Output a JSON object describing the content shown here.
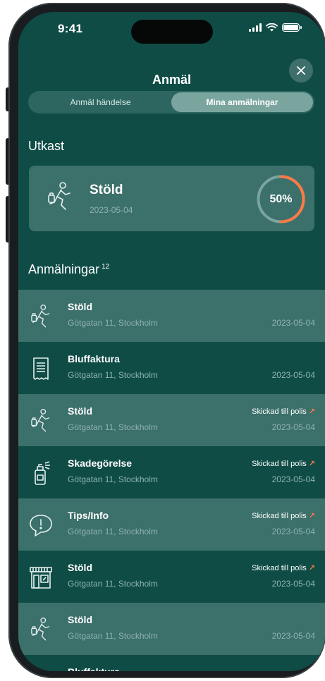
{
  "status_bar": {
    "time": "9:41"
  },
  "header": {
    "title": "Anmäl"
  },
  "tabs": [
    {
      "label": "Anmäl händelse",
      "active": false
    },
    {
      "label": "Mina anmälningar",
      "active": true
    }
  ],
  "draft": {
    "section_title": "Utkast",
    "type": "Stöld",
    "date": "2023-05-04",
    "progress_label": "50%",
    "progress": 0.5,
    "icon": "running-thief-icon"
  },
  "reports": {
    "section_title": "Anmälningar",
    "count": "12",
    "items": [
      {
        "icon": "running-thief-icon",
        "title": "Stöld",
        "address": "Götgatan 11, Stockholm",
        "status": "",
        "date": "2023-05-04",
        "shade": "light"
      },
      {
        "icon": "receipt-icon",
        "title": "Bluffaktura",
        "address": "Götgatan 11, Stockholm",
        "status": "",
        "date": "2023-05-04",
        "shade": "dark"
      },
      {
        "icon": "running-thief-icon",
        "title": "Stöld",
        "address": "Götgatan 11, Stockholm",
        "status": "Skickad till polis",
        "date": "2023-05-04",
        "shade": "light"
      },
      {
        "icon": "spray-can-icon",
        "title": "Skadegörelse",
        "address": "Götgatan 11, Stockholm",
        "status": "Skickad till polis",
        "date": "2023-05-04",
        "shade": "dark"
      },
      {
        "icon": "speech-bubble-icon",
        "title": "Tips/Info",
        "address": "Götgatan 11, Stockholm",
        "status": "Skickad till polis",
        "date": "2023-05-04",
        "shade": "light"
      },
      {
        "icon": "store-icon",
        "title": "Stöld",
        "address": "Götgatan 11, Stockholm",
        "status": "Skickad till polis",
        "date": "2023-05-04",
        "shade": "dark"
      },
      {
        "icon": "running-thief-icon",
        "title": "Stöld",
        "address": "Götgatan 11, Stockholm",
        "status": "",
        "date": "2023-05-04",
        "shade": "light"
      },
      {
        "icon": "receipt-icon",
        "title": "Bluffaktura",
        "address": "",
        "status": "",
        "date": "",
        "shade": "dark"
      }
    ]
  },
  "colors": {
    "background": "#0f4c46",
    "card": "#3c706a",
    "accent": "#ff7a45",
    "muted_text": "#8fb3ae"
  }
}
